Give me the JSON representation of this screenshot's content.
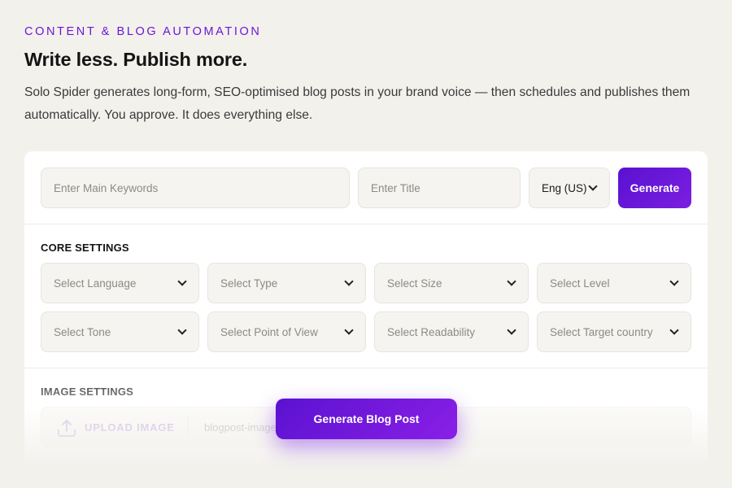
{
  "eyebrow": "CONTENT & BLOG AUTOMATION",
  "headline": "Write less. Publish more.",
  "lead": "Solo Spider generates long-form, SEO-optimised blog posts in your brand voice — then schedules and publishes them automatically. You approve. It does everything else.",
  "top_row": {
    "keywords_placeholder": "Enter Main Keywords",
    "title_placeholder": "Enter Title",
    "language_value": "Eng (US)",
    "generate_label": "Generate"
  },
  "core_settings": {
    "title": "CORE SETTINGS",
    "selects": [
      "Select Language",
      "Select Type",
      "Select Size",
      "Select Level",
      "Select Tone",
      "Select Point of View",
      "Select Readability",
      "Select Target country"
    ]
  },
  "image_settings": {
    "title": "IMAGE SETTINGS",
    "upload_label": "UPLOAD IMAGE",
    "file_name": "blogpost-image"
  },
  "cta_label": "Generate Blog Post",
  "colors": {
    "accent": "#6b17d6",
    "button": "#5a11d1",
    "background": "#f3f1ec"
  },
  "icons": {
    "chevron": "chevron-down-icon",
    "upload": "upload-icon"
  }
}
